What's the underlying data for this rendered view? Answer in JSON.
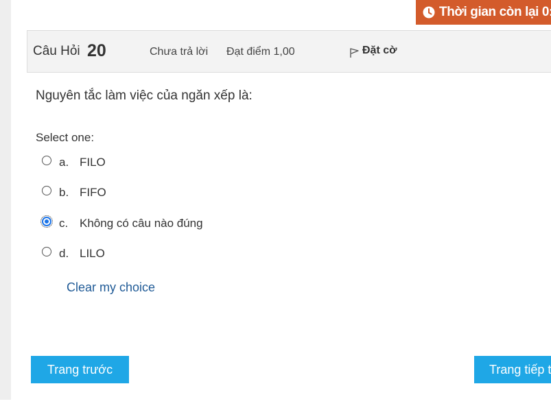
{
  "timer": {
    "label": "Thời gian còn lại 0:",
    "icon": "clock-icon"
  },
  "question_info": {
    "word": "Câu Hỏi",
    "number": "20",
    "state": "Chưa trả lời",
    "grade": "Đạt điểm 1,00",
    "flag_label": "Đặt cờ",
    "flag_icon": "flag-icon"
  },
  "question": {
    "text": "Nguyên tắc làm việc của ngăn xếp là:",
    "prompt": "Select one:",
    "options": [
      {
        "letter": "a.",
        "text": "FILO",
        "selected": false
      },
      {
        "letter": "b.",
        "text": "FIFO",
        "selected": false
      },
      {
        "letter": "c.",
        "text": "Không có câu nào đúng",
        "selected": true
      },
      {
        "letter": "d.",
        "text": "LILO",
        "selected": false
      }
    ],
    "clear_label": "Clear my choice"
  },
  "navigation": {
    "prev_label": "Trang trước",
    "next_label": "Trang tiếp t"
  },
  "colors": {
    "timer_bg": "#d35b2b",
    "button_bg": "#1fa7e6",
    "link": "#1f5a96",
    "radio_selected": "#1a73e8"
  }
}
